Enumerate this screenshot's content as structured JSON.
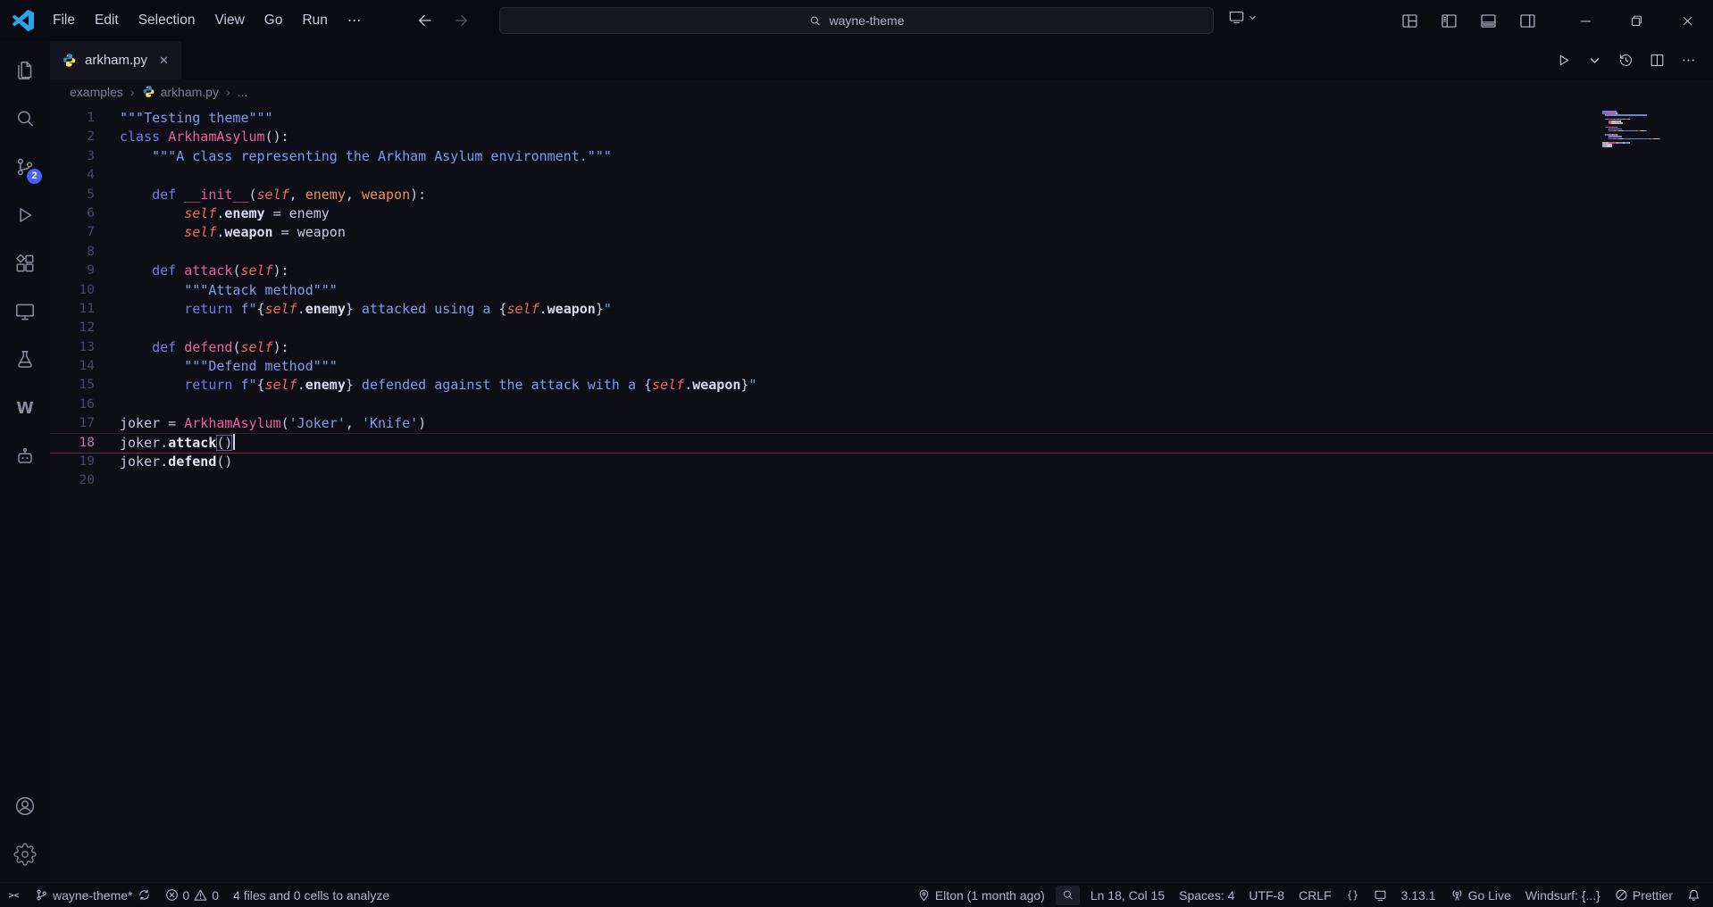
{
  "colors": {
    "accent": "#2ba3e8",
    "badge": "#4263f5",
    "current_line": "#ee5d98",
    "tokens": {
      "doc": "#7e9bef",
      "kw": "#7477ec",
      "cls": "#ee5fa0",
      "fn": "#ee5fa0",
      "slf": "#ee6a5f",
      "par": "#ef8e57",
      "str": "#7e9bef",
      "pln": "#cac6e4",
      "mth": "#e8e5f5",
      "pun": "#cac6e4",
      "op": "#cac6e4",
      "prp": "#dcd9ef",
      "bm": "#cac6e4"
    }
  },
  "title_bar": {
    "menus": [
      "File",
      "Edit",
      "Selection",
      "View",
      "Go",
      "Run"
    ],
    "menu_more": "⋯",
    "search_value": "wayne-theme",
    "layout_icons": [
      "customize-layout-icon",
      "sidebar-left-icon",
      "panel-icon",
      "sidebar-right-icon"
    ],
    "window_controls": [
      "minimize-icon",
      "restore-icon",
      "close-icon"
    ]
  },
  "activity_bar": {
    "top": [
      {
        "name": "explorer",
        "icon": "files-icon"
      },
      {
        "name": "search",
        "icon": "search-icon"
      },
      {
        "name": "source-control",
        "icon": "source-control-icon",
        "badge": "2"
      },
      {
        "name": "run-and-debug",
        "icon": "run-debug-icon"
      },
      {
        "name": "extensions",
        "icon": "extensions-icon"
      },
      {
        "name": "remote-explorer",
        "icon": "remote-explorer-icon"
      },
      {
        "name": "testing",
        "icon": "flask-icon"
      },
      {
        "name": "wakatime",
        "icon": "wakatime-icon"
      },
      {
        "name": "cascade",
        "icon": "robot-icon"
      }
    ],
    "bottom": [
      {
        "name": "accounts",
        "icon": "account-icon"
      },
      {
        "name": "settings",
        "icon": "gear-icon"
      }
    ]
  },
  "tab_bar": {
    "tabs": [
      {
        "label": "arkham.py",
        "icon": "python-icon",
        "active": true
      }
    ],
    "actions": [
      "run-icon",
      "chevron-down-icon",
      "history-icon",
      "split-editor-icon",
      "ellipsis-icon"
    ]
  },
  "breadcrumb": {
    "items": [
      {
        "label": "examples"
      },
      {
        "label": "arkham.py",
        "icon": "python-icon"
      },
      {
        "label": "..."
      }
    ]
  },
  "editor": {
    "cursor": {
      "line": 18,
      "col": 15
    },
    "lines": [
      {
        "n": 1,
        "t": [
          [
            "doc",
            "\"\"\"Testing theme\"\"\""
          ]
        ]
      },
      {
        "n": 2,
        "t": [
          [
            "kw",
            "class "
          ],
          [
            "cls",
            "ArkhamAsylum"
          ],
          [
            "pun",
            "():"
          ]
        ]
      },
      {
        "n": 3,
        "t": [
          [
            "doc",
            "    \"\"\"A class representing the Arkham Asylum environment.\"\"\""
          ]
        ]
      },
      {
        "n": 4,
        "t": []
      },
      {
        "n": 5,
        "t": [
          [
            "pln",
            "    "
          ],
          [
            "kw",
            "def "
          ],
          [
            "fn",
            "__init__"
          ],
          [
            "pun",
            "("
          ],
          [
            "slf",
            "self"
          ],
          [
            "pun",
            ", "
          ],
          [
            "par",
            "enemy"
          ],
          [
            "pun",
            ", "
          ],
          [
            "par",
            "weapon"
          ],
          [
            "pun",
            "):"
          ]
        ]
      },
      {
        "n": 6,
        "t": [
          [
            "pln",
            "        "
          ],
          [
            "slf",
            "self"
          ],
          [
            "pun",
            "."
          ],
          [
            "prp",
            "enemy"
          ],
          [
            "op",
            " = "
          ],
          [
            "pln",
            "enemy"
          ]
        ]
      },
      {
        "n": 7,
        "t": [
          [
            "pln",
            "        "
          ],
          [
            "slf",
            "self"
          ],
          [
            "pun",
            "."
          ],
          [
            "prp",
            "weapon"
          ],
          [
            "op",
            " = "
          ],
          [
            "pln",
            "weapon"
          ]
        ]
      },
      {
        "n": 8,
        "t": []
      },
      {
        "n": 9,
        "t": [
          [
            "pln",
            "    "
          ],
          [
            "kw",
            "def "
          ],
          [
            "fn",
            "attack"
          ],
          [
            "pun",
            "("
          ],
          [
            "slf",
            "self"
          ],
          [
            "pun",
            "):"
          ]
        ]
      },
      {
        "n": 10,
        "t": [
          [
            "doc",
            "        \"\"\"Attack method\"\"\""
          ]
        ]
      },
      {
        "n": 11,
        "t": [
          [
            "pln",
            "        "
          ],
          [
            "kw",
            "return "
          ],
          [
            "str",
            "f\""
          ],
          [
            "pun",
            "{"
          ],
          [
            "slf",
            "self"
          ],
          [
            "pun",
            "."
          ],
          [
            "prp",
            "enemy"
          ],
          [
            "pun",
            "}"
          ],
          [
            "str",
            " attacked using a "
          ],
          [
            "pun",
            "{"
          ],
          [
            "slf",
            "self"
          ],
          [
            "pun",
            "."
          ],
          [
            "prp",
            "weapon"
          ],
          [
            "pun",
            "}"
          ],
          [
            "str",
            "\""
          ]
        ]
      },
      {
        "n": 12,
        "t": []
      },
      {
        "n": 13,
        "t": [
          [
            "pln",
            "    "
          ],
          [
            "kw",
            "def "
          ],
          [
            "fn",
            "defend"
          ],
          [
            "pun",
            "("
          ],
          [
            "slf",
            "self"
          ],
          [
            "pun",
            "):"
          ]
        ]
      },
      {
        "n": 14,
        "t": [
          [
            "doc",
            "        \"\"\"Defend method\"\"\""
          ]
        ]
      },
      {
        "n": 15,
        "t": [
          [
            "pln",
            "        "
          ],
          [
            "kw",
            "return "
          ],
          [
            "str",
            "f\""
          ],
          [
            "pun",
            "{"
          ],
          [
            "slf",
            "self"
          ],
          [
            "pun",
            "."
          ],
          [
            "prp",
            "enemy"
          ],
          [
            "pun",
            "}"
          ],
          [
            "str",
            " defended against the attack with a "
          ],
          [
            "pun",
            "{"
          ],
          [
            "slf",
            "self"
          ],
          [
            "pun",
            "."
          ],
          [
            "prp",
            "weapon"
          ],
          [
            "pun",
            "}"
          ],
          [
            "str",
            "\""
          ]
        ]
      },
      {
        "n": 16,
        "t": []
      },
      {
        "n": 17,
        "t": [
          [
            "pln",
            "joker"
          ],
          [
            "op",
            " = "
          ],
          [
            "cls",
            "ArkhamAsylum"
          ],
          [
            "pun",
            "("
          ],
          [
            "str",
            "'Joker'"
          ],
          [
            "pun",
            ", "
          ],
          [
            "str",
            "'Knife'"
          ],
          [
            "pun",
            ")"
          ]
        ]
      },
      {
        "n": 18,
        "current": true,
        "t": [
          [
            "pln",
            "joker"
          ],
          [
            "pun",
            "."
          ],
          [
            "mth",
            "attack"
          ],
          [
            "bm",
            "()"
          ],
          [
            "cur",
            ""
          ]
        ]
      },
      {
        "n": 19,
        "t": [
          [
            "pln",
            "joker"
          ],
          [
            "pun",
            "."
          ],
          [
            "mth",
            "defend"
          ],
          [
            "pun",
            "()"
          ]
        ]
      },
      {
        "n": 20,
        "t": []
      }
    ]
  },
  "status_bar": {
    "left": [
      {
        "name": "remote",
        "icon": "remote-icon"
      },
      {
        "name": "branch",
        "icon": "branch-icon",
        "label": "wayne-theme*",
        "icon_after": "sync-icon"
      },
      {
        "name": "problems",
        "icon": "error-icon",
        "label": "0",
        "icon2": "warning-icon",
        "label2": "0"
      },
      {
        "name": "analysis",
        "label": "4 files and 0 cells to analyze"
      }
    ],
    "right": [
      {
        "name": "blame",
        "icon": "pin-icon",
        "label": "Elton (1 month ago)"
      },
      {
        "name": "search-toggle",
        "icon": "search-icon",
        "boxed": true
      },
      {
        "name": "cursor-position",
        "label": "Ln 18, Col 15"
      },
      {
        "name": "indentation",
        "label": "Spaces: 4"
      },
      {
        "name": "encoding",
        "label": "UTF-8"
      },
      {
        "name": "eol",
        "label": "CRLF"
      },
      {
        "name": "braces",
        "icon": "braces-icon"
      },
      {
        "name": "kernel",
        "icon": "kernel-icon"
      },
      {
        "name": "python-version",
        "label": "3.13.1"
      },
      {
        "name": "go-live",
        "icon": "broadcast-icon",
        "label": "Go Live"
      },
      {
        "name": "windsurf",
        "label": "Windsurf: {...}"
      },
      {
        "name": "prettier",
        "icon": "prettier-icon",
        "label": "Prettier"
      },
      {
        "name": "notifications",
        "icon": "bell-icon"
      }
    ]
  }
}
